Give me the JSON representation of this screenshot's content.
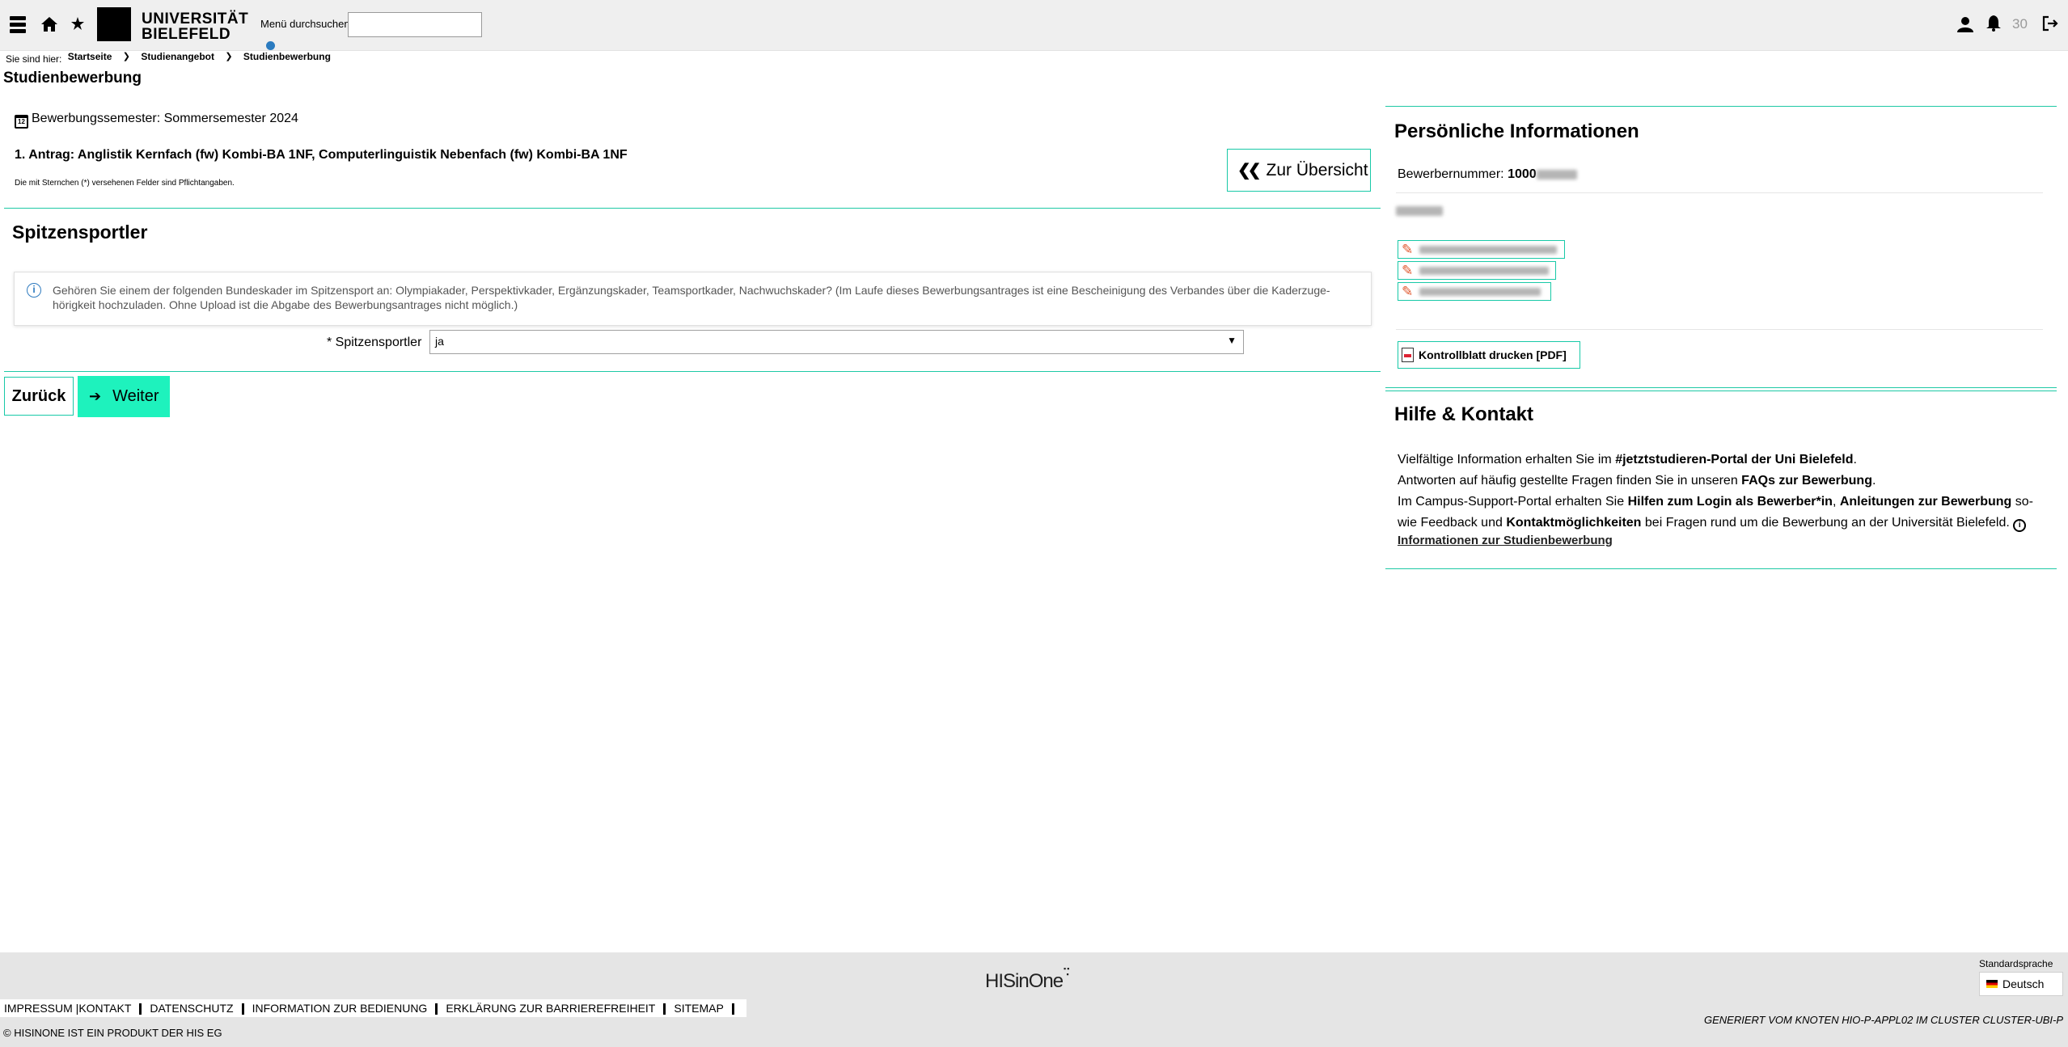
{
  "header": {
    "logo_line1": "UNIVERSITÄT",
    "logo_line2": "BIELEFELD",
    "menu_search_label": "Menü durchsuchen",
    "menu_search_value": "",
    "notification_count": "30"
  },
  "breadcrumb": {
    "prefix": "Sie sind hier:",
    "items": [
      "Startseite",
      "Studienangebot",
      "Studienbewerbung"
    ]
  },
  "page_title": "Studienbewerbung",
  "application": {
    "semester": "Bewerbungssemester: Sommersemester 2024",
    "antrag": "1. Antrag: Anglistik Kernfach (fw) Kombi-BA 1NF, Computerlinguistik Nebenfach (fw) Kombi-BA 1NF",
    "required_note": "Die mit Sternchen (*) versehenen Felder sind Pflichtangaben.",
    "overview_button": "Zur Übersicht"
  },
  "section": {
    "title": "Spitzensportler",
    "info_line1": "Gehören Sie einem der folgenden Bundeskader im Spitzensport an: Olympiakader, Perspektivkader, Ergänzungskader, Teamsportkader, Nachwuchskader? (Im Laufe dieses Bewerbungsantrages ist eine Bescheinigung des Verbandes über die Kaderzuge-",
    "info_line2": "hörigkeit hochzuladen. Ohne Upload ist die Abgabe des Bewerbungsantrages nicht möglich.)",
    "field_label": "* Spitzensportler",
    "field_value": "ja"
  },
  "buttons": {
    "back": "Zurück",
    "next": "Weiter"
  },
  "personal": {
    "title": "Persönliche Informationen",
    "applicant_number_label": "Bewerbernummer:",
    "applicant_number_visible": "1000",
    "pdf_button": "Kontrollblatt drucken [PDF]"
  },
  "help": {
    "title": "Hilfe & Kontakt",
    "line1_pre": "Vielfältige Information erhalten Sie im ",
    "line1_link": "#jetztstudieren-Portal der Uni Bielefeld",
    "line1_post": ".",
    "line2_pre": "Antworten auf häufig gestellte Fragen finden Sie in unseren ",
    "line2_link": "FAQs zur Bewerbung",
    "line2_post": ".",
    "line3_pre": "Im Campus-Support-Portal erhalten Sie ",
    "line3_link1": "Hilfen zum Login als Bewerber*in",
    "line3_sep": ", ",
    "line3_link2": "Anleitungen zur Bewerbung",
    "line3_post": " so-",
    "line4_pre": "wie Feedback und ",
    "line4_link": "Kontaktmöglichkeiten",
    "line4_post": " bei Fragen rund um die Bewerbung an der Universität Bielefeld.",
    "info_link": "Informationen zur Studienbewerbung"
  },
  "footer": {
    "brand": "HISinOne",
    "links": [
      "IMPRESSUM |KONTAKT",
      "DATENSCHUTZ",
      "INFORMATION ZUR BEDIENUNG",
      "ERKLÄRUNG ZUR BARRIEREFREIHEIT",
      "SITEMAP"
    ],
    "copyright": "© HISINONE IST EIN PRODUKT DER HIS EG",
    "generated": "GENERIERT VOM KNOTEN HIO-P-APPL02 IM CLUSTER CLUSTER-UBI-P",
    "lang_label": "Standardsprache",
    "lang_value": "Deutsch"
  },
  "colors": {
    "accent": "#1ec9a5",
    "button_next": "#1ef2bd",
    "topbar": "#efefef"
  }
}
